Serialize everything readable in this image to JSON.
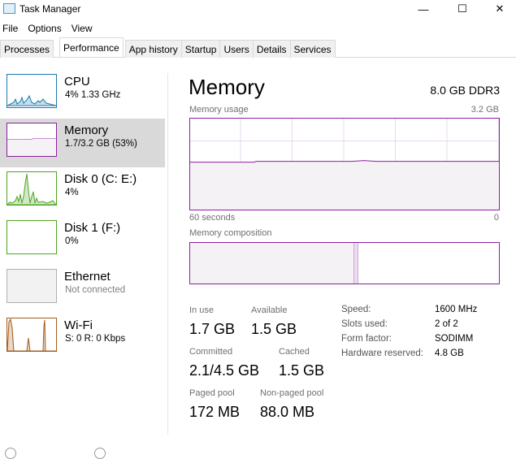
{
  "window": {
    "title": "Task Manager",
    "minimize": "—",
    "maximize": "☐",
    "close": "✕"
  },
  "menu": [
    "File",
    "Options",
    "View"
  ],
  "tabs": [
    {
      "label": "Processes"
    },
    {
      "label": "Performance",
      "active": true
    },
    {
      "label": "App history"
    },
    {
      "label": "Startup"
    },
    {
      "label": "Users"
    },
    {
      "label": "Details"
    },
    {
      "label": "Services"
    }
  ],
  "sidebar": [
    {
      "name": "CPU",
      "sub": "4% 1.33 GHz",
      "color": "#1a7ab0"
    },
    {
      "name": "Memory",
      "sub": "1.7/3.2 GB (53%)",
      "color": "#8b1fa0",
      "selected": true
    },
    {
      "name": "Disk 0 (C: E:)",
      "sub": "4%",
      "color": "#4da520"
    },
    {
      "name": "Disk 1 (F:)",
      "sub": "0%",
      "color": "#4da520"
    },
    {
      "name": "Ethernet",
      "sub": "Not connected",
      "color": "#b0b0b0"
    },
    {
      "name": "Wi-Fi",
      "sub": "S: 0 R: 0 Kbps",
      "color": "#a45a1a"
    }
  ],
  "main": {
    "title": "Memory",
    "spec": "8.0 GB DDR3",
    "usage_label": "Memory usage",
    "usage_max": "3.2 GB",
    "time_left": "60 seconds",
    "time_right": "0",
    "usage_percent": 53,
    "composition_label": "Memory composition",
    "composition": {
      "in_use_percent": 53,
      "modified_percent": 1.5
    },
    "stats": {
      "in_use": {
        "label": "In use",
        "value": "1.7 GB"
      },
      "available": {
        "label": "Available",
        "value": "1.5 GB"
      },
      "committed": {
        "label": "Committed",
        "value": "2.1/4.5 GB"
      },
      "cached": {
        "label": "Cached",
        "value": "1.5 GB"
      },
      "paged": {
        "label": "Paged pool",
        "value": "172 MB"
      },
      "nonpaged": {
        "label": "Non-paged pool",
        "value": "88.0 MB"
      }
    },
    "specs": [
      {
        "k": "Speed:",
        "v": "1600 MHz"
      },
      {
        "k": "Slots used:",
        "v": "2 of 2"
      },
      {
        "k": "Form factor:",
        "v": "SODIMM"
      },
      {
        "k": "Hardware reserved:",
        "v": "4.8 GB"
      }
    ],
    "accent": "#8b1fa0"
  }
}
